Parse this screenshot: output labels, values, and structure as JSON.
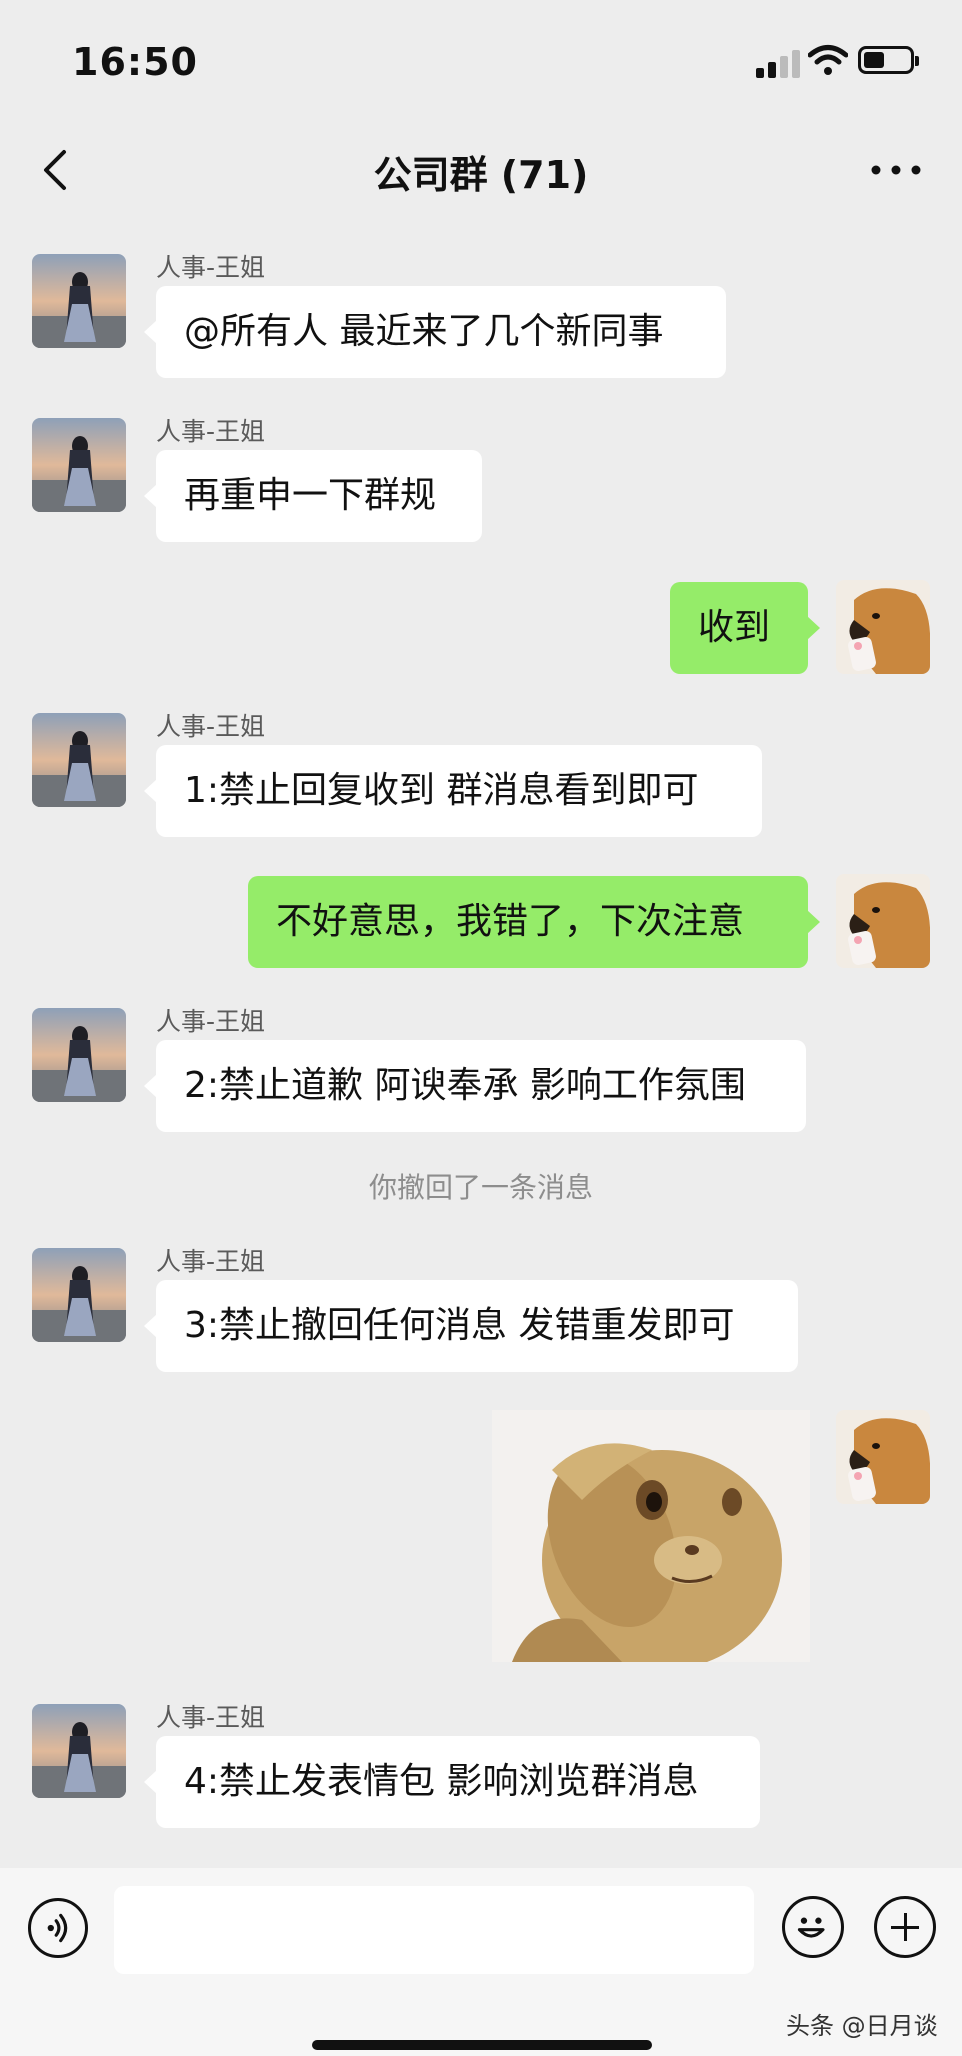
{
  "status_bar": {
    "time": "16:50"
  },
  "header": {
    "title": "公司群 (71)"
  },
  "messages": [
    {
      "sender": "人事-王姐",
      "text": "@所有人 最近来了几个新同事"
    },
    {
      "sender": "人事-王姐",
      "text": "再重申一下群规"
    },
    {
      "text": "收到"
    },
    {
      "sender": "人事-王姐",
      "text": "1:禁止回复收到  群消息看到即可"
    },
    {
      "text": "不好意思，我错了，下次注意"
    },
    {
      "sender": "人事-王姐",
      "text": "2:禁止道歉 阿谀奉承 影响工作氛围"
    },
    {
      "text": "你撤回了一条消息"
    },
    {
      "sender": "人事-王姐",
      "text": "3:禁止撤回任何消息 发错重发即可"
    },
    {
      "sticker": "cat-salute-sticker"
    },
    {
      "sender": "人事-王姐",
      "text": "4:禁止发表情包 影响浏览群消息"
    }
  ],
  "icons": {
    "back": "chevron-left-icon",
    "more": "more-icon",
    "voice": "voice-icon",
    "emoji": "emoji-icon",
    "plus": "plus-icon"
  },
  "colors": {
    "incoming_bubble": "#ffffff",
    "outgoing_bubble": "#95ec69",
    "background": "#ededed"
  },
  "watermark": "头条 @日月谈"
}
